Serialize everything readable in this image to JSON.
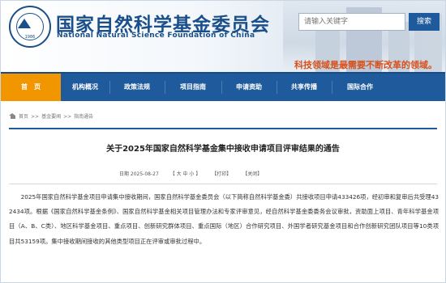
{
  "header": {
    "logo_year": "1986",
    "title_cn": "国家自然科学基金委员会",
    "title_en": "National Natural Science Foundation of China",
    "slogan": "科技领域是最需要不断改革的领域。"
  },
  "search": {
    "placeholder": "请输入关键字",
    "button_label": "搜索"
  },
  "nav": {
    "items": [
      {
        "label": "首　页"
      },
      {
        "label": "机构概况"
      },
      {
        "label": "政策法规"
      },
      {
        "label": "项目指南"
      },
      {
        "label": "申请资助"
      },
      {
        "label": "共享传播"
      },
      {
        "label": "国际合作"
      }
    ]
  },
  "breadcrumb": {
    "items": [
      "首页",
      ">>",
      "基金要闻",
      ">>",
      "指南通告"
    ]
  },
  "article": {
    "title": "关于2025年国家自然科学基金集中接收申请项目评审结果的通告",
    "date": "日期 2025-08-27",
    "font_size": "【 大 中 小 】",
    "print": "【打印】",
    "close": "【关闭】",
    "body": "2025年国家自然科学基金项目申请集中接收期间，国家自然科学基金委员会（以下简称自然科学基金委）共接收项目申请433426项，经初审和复审后共受理432434项。根据《国家自然科学基金条例》、国家自然科学基金相关项目管理办法和专家评审意见，经自然科学基金委委务会议审批，资助面上项目、青年科学基金项目（A、B、C类）、地区科学基金项目、重点项目、创新研究群体项目、重点国际（地区）合作研究项目、外国学者研究基金项目和合作创新研究团队项目等10类项目共53159项。集中接收期间接收的其他类型项目正在评审或审批过程中。"
  }
}
